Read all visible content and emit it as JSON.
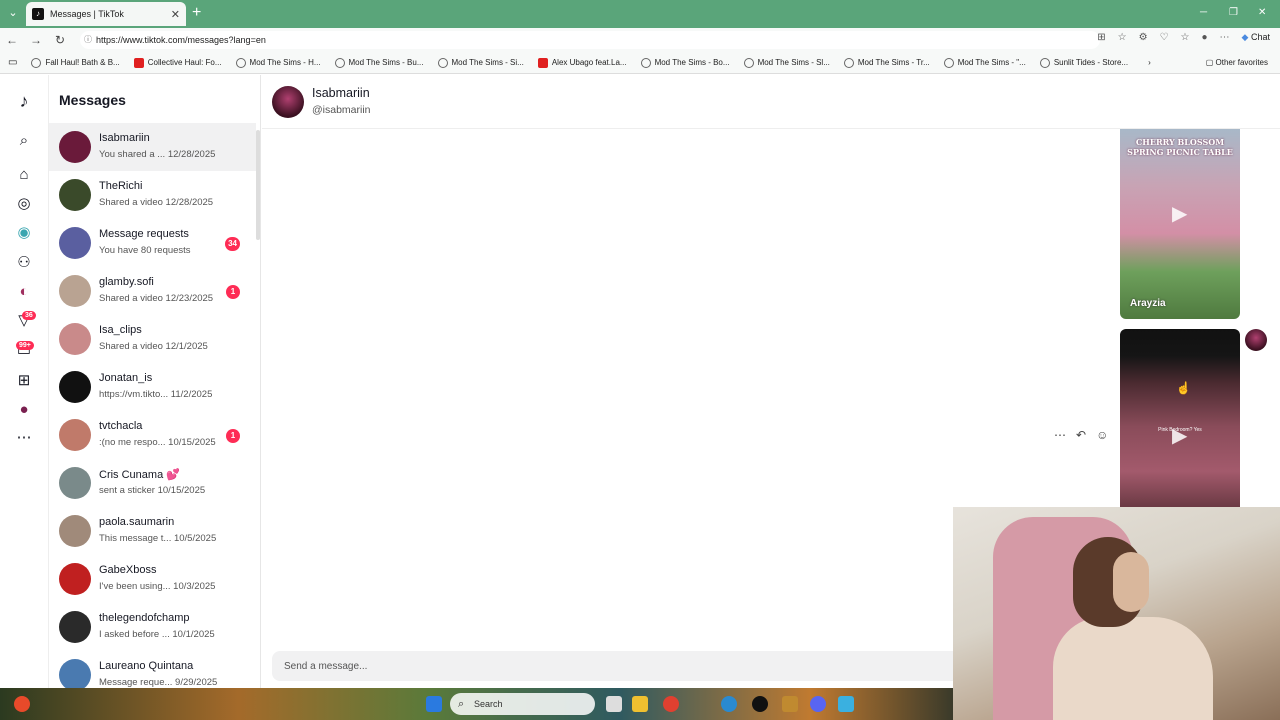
{
  "browser": {
    "tab_title": "Messages | TikTok",
    "url": "https://www.tiktok.com/messages?lang=en",
    "chat_label": "Chat",
    "bookmarks": [
      {
        "label": "Fall Haul! Bath & B...",
        "icon": "globe"
      },
      {
        "label": "Collective Haul: Fo...",
        "icon": "youtube"
      },
      {
        "label": "Mod The Sims - H...",
        "icon": "mts"
      },
      {
        "label": "Mod The Sims - Bu...",
        "icon": "globe"
      },
      {
        "label": "Mod The Sims - Si...",
        "icon": "globe"
      },
      {
        "label": "Alex Ubago feat.La...",
        "icon": "youtube"
      },
      {
        "label": "Mod The Sims - Bo...",
        "icon": "globe"
      },
      {
        "label": "Mod The Sims - Sl...",
        "icon": "globe"
      },
      {
        "label": "Mod The Sims - Tr...",
        "icon": "mts"
      },
      {
        "label": "Mod The Sims - \"...",
        "icon": "globe"
      },
      {
        "label": "Sunlit Tides - Store...",
        "icon": "globe"
      }
    ],
    "other_favorites": "Other favorites"
  },
  "rail": {
    "badge_inbox": "36",
    "badge_messages": "99+"
  },
  "sidebar": {
    "title": "Messages",
    "conversations": [
      {
        "name": "Isabmariin",
        "preview": "You shared a ... 12/28/2025",
        "badge": "",
        "color": "#6a1a3a"
      },
      {
        "name": "TheRichi",
        "preview": "Shared a video 12/28/2025",
        "badge": "",
        "color": "#3a4a2a"
      },
      {
        "name": "Message requests",
        "preview": "You have 80 requests",
        "badge": "34",
        "color": "#5a5fa0"
      },
      {
        "name": "glamby.sofi",
        "preview": "Shared a video 12/23/2025",
        "badge": "1",
        "color": "#b9a392"
      },
      {
        "name": "Isa_clips",
        "preview": "Shared a video 12/1/2025",
        "badge": "",
        "color": "#c98a8a"
      },
      {
        "name": "Jonatan_is",
        "preview": "https://vm.tikto... 11/2/2025",
        "badge": "",
        "color": "#111111"
      },
      {
        "name": "tvtchacla",
        "preview": ":(no me respo... 10/15/2025",
        "badge": "1",
        "color": "#c07a6a"
      },
      {
        "name": "Cris Cunama 💕",
        "preview": "sent a sticker 10/15/2025",
        "badge": "",
        "color": "#7a8a8a"
      },
      {
        "name": "paola.saumarin",
        "preview": "This message t... 10/5/2025",
        "badge": "",
        "color": "#a08a7a"
      },
      {
        "name": "GabeXboss",
        "preview": "I've been using... 10/3/2025",
        "badge": "",
        "color": "#c02020"
      },
      {
        "name": "thelegendofchamp",
        "preview": "I asked before ... 10/1/2025",
        "badge": "",
        "color": "#2a2a2a"
      },
      {
        "name": "Laureano Quintana",
        "preview": "Message reque... 9/29/2025",
        "badge": "",
        "color": "#4a7ab0"
      }
    ]
  },
  "chat": {
    "name": "Isabmariin",
    "handle": "@isabmariin",
    "video1": {
      "title": "CHERRY BLOSSOM SPRING PICNIC TABLE",
      "author": "Arayzia"
    },
    "video2": {
      "caption": "Pink Bedroom? Yes"
    },
    "input_placeholder": "Send a message..."
  },
  "taskbar": {
    "search_placeholder": "Search"
  }
}
